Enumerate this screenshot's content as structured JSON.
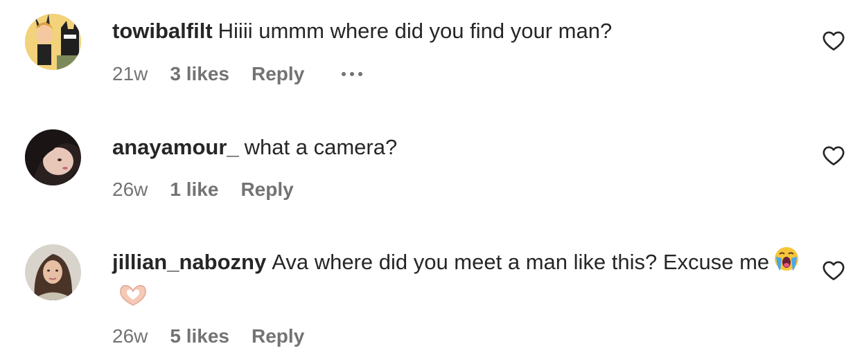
{
  "comments": [
    {
      "username": "towibalfilt",
      "text": "Hiiii ummm where did you find your man?",
      "time": "21w",
      "likes": "3 likes",
      "reply": "Reply",
      "avatar_icon": "cartoon-avatar-icon"
    },
    {
      "username": "anayamour_",
      "text": "what a camera?",
      "time": "26w",
      "likes": "1 like",
      "reply": "Reply",
      "avatar_icon": "profile-photo-icon"
    },
    {
      "username": "jillian_nabozny",
      "text": "Ava where did you meet a man like this? Excuse me",
      "time": "26w",
      "likes": "5 likes",
      "reply": "Reply",
      "emojis": [
        "crying-face-emoji",
        "heart-hands-emoji"
      ],
      "avatar_icon": "profile-photo-icon"
    }
  ],
  "icons": {
    "like": "heart-outline-icon",
    "more": "more-options-icon"
  },
  "colors": {
    "text": "#262626",
    "secondary": "#737373",
    "background": "#ffffff"
  }
}
